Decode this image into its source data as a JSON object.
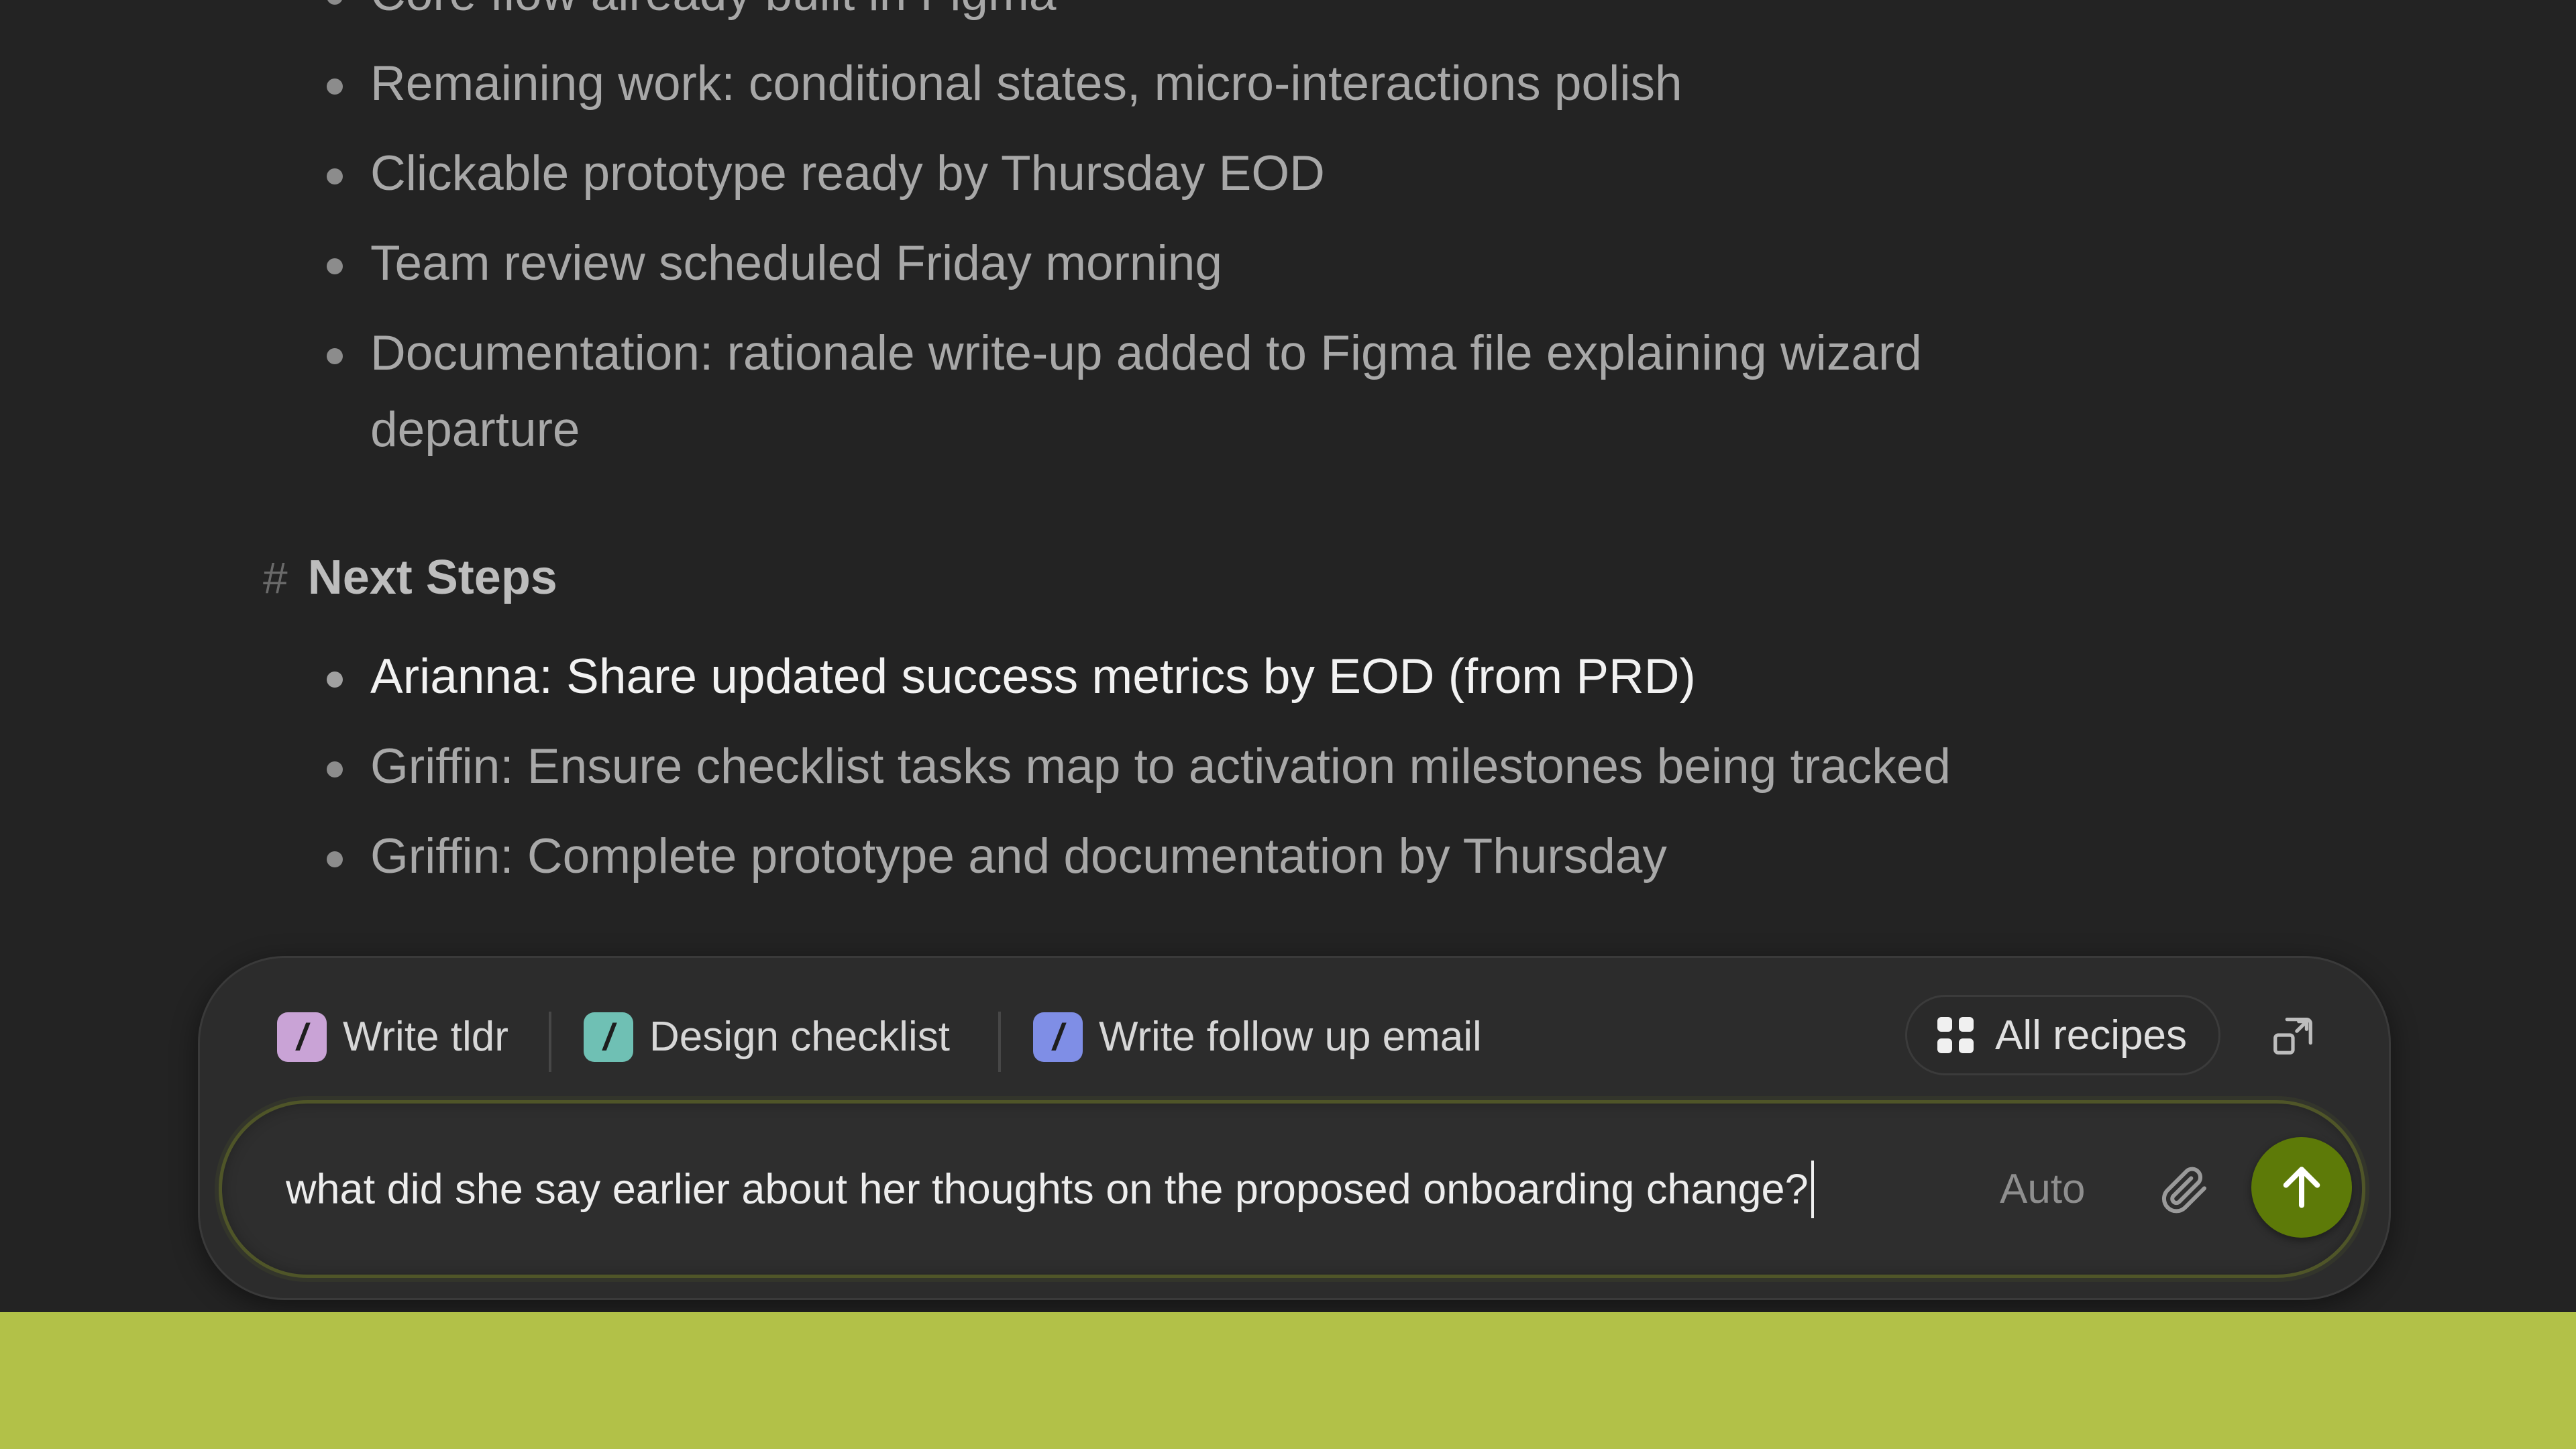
{
  "document": {
    "bullets_top": [
      {
        "text": "Core flow already built in Figma",
        "highlight": false
      },
      {
        "text": "Remaining work: conditional states, micro-interactions polish",
        "highlight": false
      },
      {
        "text": "Clickable prototype ready by Thursday EOD",
        "highlight": false
      },
      {
        "text": "Team review scheduled Friday morning",
        "highlight": false
      },
      {
        "text": "Documentation: rationale write-up added to Figma file explaining wizard departure",
        "highlight": false
      }
    ],
    "next_steps": {
      "hash": "#",
      "heading": "Next Steps",
      "items": [
        {
          "text": "Arianna: Share updated success metrics by EOD (from PRD)",
          "highlight": true
        },
        {
          "text": "Griffin: Ensure checklist tasks map to activation milestones being tracked",
          "highlight": false
        },
        {
          "text": "Griffin: Complete prototype and documentation by Thursday",
          "highlight": false
        }
      ]
    }
  },
  "composer": {
    "recipes": [
      {
        "label": "Write tldr",
        "icon": "slash-icon",
        "color": "#c9a3d6"
      },
      {
        "label": "Design checklist",
        "icon": "slash-icon",
        "color": "#6fc0b4"
      },
      {
        "label": "Write follow up email",
        "icon": "slash-icon",
        "color": "#7f8ee6"
      }
    ],
    "all_recipes_label": "All recipes",
    "input_value": "what did she say earlier about her thoughts on the proposed onboarding change?",
    "mode_label": "Auto",
    "send_color": "#5d7a08",
    "accent_band_color": "#b2c148"
  }
}
